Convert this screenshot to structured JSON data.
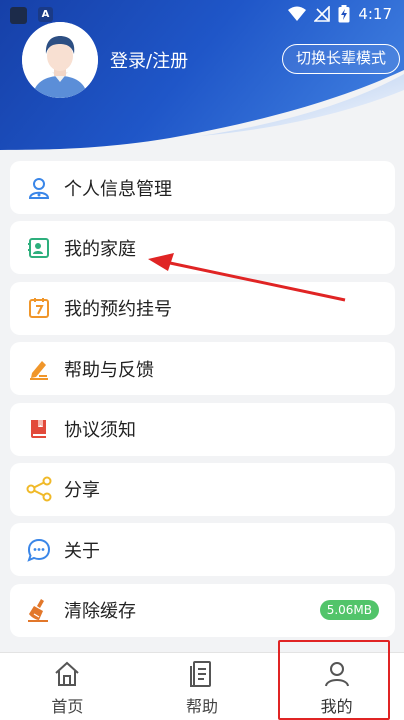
{
  "status_bar": {
    "time": "4:17",
    "app_badge": "A",
    "icons": [
      "app-icon",
      "wifi-icon",
      "no-signal-icon",
      "battery-charging-icon"
    ]
  },
  "profile": {
    "login_label": "登录/注册",
    "mode_button": "切换长辈模式",
    "avatar_icon": "default-user-avatar"
  },
  "menu": [
    {
      "label": "个人信息管理",
      "icon": "person-icon",
      "color": "#3a86e8"
    },
    {
      "label": "我的家庭",
      "icon": "family-card-icon",
      "color": "#2eaf7d"
    },
    {
      "label": "我的预约挂号",
      "icon": "calendar-icon",
      "color": "#f0962a"
    },
    {
      "label": "帮助与反馈",
      "icon": "edit-feedback-icon",
      "color": "#f0962a"
    },
    {
      "label": "协议须知",
      "icon": "book-icon",
      "color": "#e24a3b"
    },
    {
      "label": "分享",
      "icon": "share-icon",
      "color": "#f0b928"
    },
    {
      "label": "关于",
      "icon": "chat-bubble-icon",
      "color": "#3a86e8"
    },
    {
      "label": "清除缓存",
      "icon": "broom-icon",
      "color": "#e2772a",
      "badge": "5.06MB"
    }
  ],
  "tabs": [
    {
      "label": "首页",
      "icon": "home-icon"
    },
    {
      "label": "帮助",
      "icon": "document-icon"
    },
    {
      "label": "我的",
      "icon": "user-icon",
      "active": true
    }
  ],
  "colors": {
    "header_blue": "#1e4fbf",
    "annotation_red": "#e02424",
    "badge_green": "#52c46a"
  }
}
